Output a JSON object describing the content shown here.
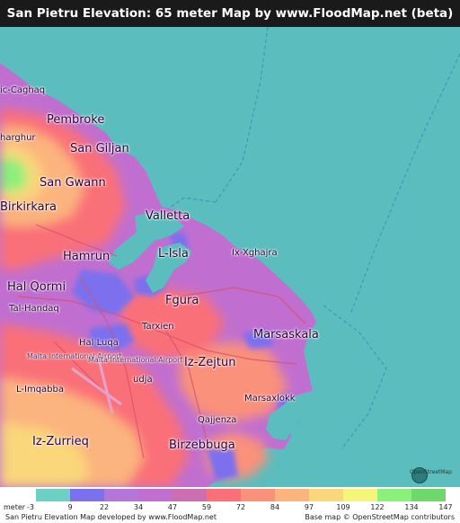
{
  "title": "San Pietru Elevation: 65 meter Map by www.FloodMap.net (beta)",
  "map": {
    "labels": [
      {
        "id": "ic-caghaq",
        "text": "ic-Caghaq"
      },
      {
        "id": "pembroke",
        "text": "Pembroke"
      },
      {
        "id": "gharghur",
        "text": "harghur"
      },
      {
        "id": "san-giljan",
        "text": "San Giljan"
      },
      {
        "id": "san-gwann",
        "text": "San Gwann"
      },
      {
        "id": "birkirkara",
        "text": "Birkirkara"
      },
      {
        "id": "valletta",
        "text": "Valletta"
      },
      {
        "id": "hamrun",
        "text": "Hamrun"
      },
      {
        "id": "l-isla",
        "text": "L-Isla"
      },
      {
        "id": "ix-xghajra",
        "text": "Ix-Xghajra"
      },
      {
        "id": "hal-qormi",
        "text": "Hal Qormi"
      },
      {
        "id": "tal-handaq",
        "text": "Tal-Handaq"
      },
      {
        "id": "fgura",
        "text": "Fgura"
      },
      {
        "id": "tarxien",
        "text": "Tarxien"
      },
      {
        "id": "marsaskala",
        "text": "Marsaskala"
      },
      {
        "id": "hal-luqa",
        "text": "Hal Luqa"
      },
      {
        "id": "malta-intl-airport-1",
        "text": "Malta International Airport"
      },
      {
        "id": "malta-intl-airport-2",
        "text": "Malta International Airport"
      },
      {
        "id": "iz-zejtun",
        "text": "Iz-Zejtun"
      },
      {
        "id": "l-imqabba",
        "text": "L-Imqabba"
      },
      {
        "id": "udja",
        "text": "udja"
      },
      {
        "id": "marsaxlokk",
        "text": "Marsaxlokk"
      },
      {
        "id": "qajjenza",
        "text": "Qajjenza"
      },
      {
        "id": "iz-zurrieq",
        "text": "Iz-Zurrieq"
      },
      {
        "id": "birzebbuga",
        "text": "Birzebbuga"
      }
    ],
    "osm_badge": "OpenStreetMap"
  },
  "legend": {
    "unit": "meter",
    "ticks": [
      "-3",
      "9",
      "22",
      "34",
      "47",
      "59",
      "72",
      "84",
      "97",
      "109",
      "122",
      "134",
      "147"
    ],
    "colors": [
      "#6ecfc4",
      "#7b70ee",
      "#b476d9",
      "#c06fd0",
      "#cc6fb2",
      "#fa6f78",
      "#fa917a",
      "#fbb47e",
      "#f9d77a",
      "#f5f57a",
      "#8af07a",
      "#6ed86a"
    ]
  },
  "footer": {
    "left": "San Pietru Elevation Map developed by www.FloodMap.net",
    "right": "Base map © OpenStreetMap contributors"
  },
  "colors": {
    "sea": "#5bbdbd",
    "title_bg": "#1a1a1a",
    "land_low": "#c06fd0",
    "land_mid": "#fa6f78",
    "land_high": "#fbb47e"
  }
}
